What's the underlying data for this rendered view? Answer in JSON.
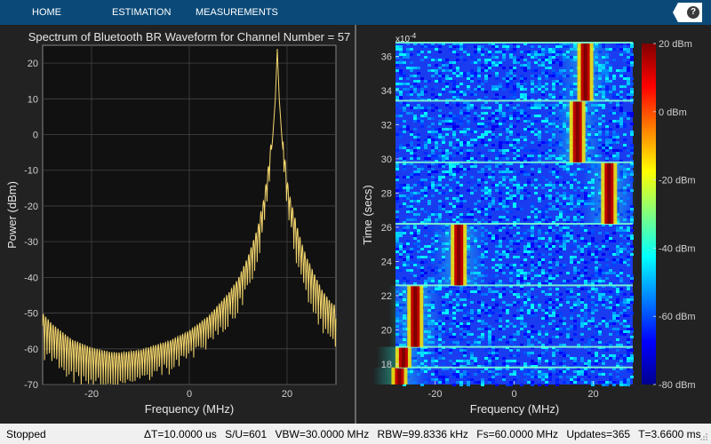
{
  "toolbar": {
    "tabs": [
      "HOME",
      "ESTIMATION",
      "MEASUREMENTS"
    ],
    "help_label": "?"
  },
  "spectrum": {
    "title": "Spectrum of Bluetooth BR Waveform for Channel Number = 57",
    "xlabel": "Frequency (MHz)",
    "ylabel": "Power (dBm)",
    "line_color": "#f5d76e"
  },
  "spectrogram": {
    "xlabel": "Frequency (MHz)",
    "ylabel": "Time (secs)",
    "exponent_base": "x10",
    "exponent_power": "-4",
    "colorbar_labels": [
      "20 dBm",
      "0 dBm",
      "-20 dBm",
      "-40 dBm",
      "-60 dBm",
      "-80 dBm"
    ]
  },
  "chart_data": [
    {
      "type": "line",
      "title": "Spectrum of Bluetooth BR Waveform for Channel Number = 57",
      "xlabel": "Frequency (MHz)",
      "ylabel": "Power (dBm)",
      "xlim": [
        -30,
        30
      ],
      "ylim": [
        -70,
        25
      ],
      "xticks": [
        "-20",
        "0",
        "20"
      ],
      "yticks": [
        "20",
        "10",
        "0",
        "-10",
        "-20",
        "-30",
        "-40",
        "-50",
        "-60",
        "-70"
      ],
      "grid": true,
      "peak": {
        "x": 18,
        "y": 24
      },
      "points": [
        [
          -30,
          -55
        ],
        [
          -28,
          -58
        ],
        [
          -26,
          -60
        ],
        [
          -24,
          -62
        ],
        [
          -22,
          -63
        ],
        [
          -20,
          -64
        ],
        [
          -18,
          -64.5
        ],
        [
          -16,
          -65
        ],
        [
          -14,
          -65
        ],
        [
          -12,
          -64.5
        ],
        [
          -10,
          -64
        ],
        [
          -8,
          -63
        ],
        [
          -6,
          -62
        ],
        [
          -4,
          -61
        ],
        [
          -2,
          -59.5
        ],
        [
          0,
          -58
        ],
        [
          2,
          -56
        ],
        [
          4,
          -54
        ],
        [
          6,
          -51
        ],
        [
          8,
          -48
        ],
        [
          10,
          -44
        ],
        [
          12,
          -38
        ],
        [
          14,
          -30
        ],
        [
          15,
          -23
        ],
        [
          16,
          -14
        ],
        [
          17,
          -2
        ],
        [
          17.6,
          10
        ],
        [
          18,
          24
        ],
        [
          18.4,
          10
        ],
        [
          19,
          -2
        ],
        [
          20,
          -16
        ],
        [
          21,
          -24
        ],
        [
          22,
          -30
        ],
        [
          23,
          -35
        ],
        [
          24,
          -39
        ],
        [
          25,
          -42
        ],
        [
          26,
          -45
        ],
        [
          27,
          -48
        ],
        [
          28,
          -50
        ],
        [
          29,
          -52
        ],
        [
          30,
          -53
        ]
      ]
    },
    {
      "type": "heatmap",
      "xlabel": "Frequency (MHz)",
      "ylabel": "Time (secs)",
      "xlim": [
        -30,
        30
      ],
      "ylim": [
        16.8,
        36.8
      ],
      "y_multiplier": "x10^-4",
      "xticks": [
        "-20",
        "0",
        "20"
      ],
      "yticks": [
        "18",
        "20",
        "22",
        "24",
        "26",
        "28",
        "30",
        "32",
        "34",
        "36"
      ],
      "colorbar": {
        "min": -80,
        "max": 20,
        "unit": "dBm"
      },
      "hops": [
        {
          "t_start": 16.8,
          "t_end": 17.8,
          "freq": -29
        },
        {
          "t_start": 17.8,
          "t_end": 19.0,
          "freq": -28
        },
        {
          "t_start": 19.0,
          "t_end": 22.6,
          "freq": -25
        },
        {
          "t_start": 22.6,
          "t_end": 26.2,
          "freq": -14
        },
        {
          "t_start": 26.2,
          "t_end": 29.8,
          "freq": 24
        },
        {
          "t_start": 29.8,
          "t_end": 33.4,
          "freq": 16
        },
        {
          "t_start": 33.4,
          "t_end": 36.8,
          "freq": 18
        }
      ]
    }
  ]
}
